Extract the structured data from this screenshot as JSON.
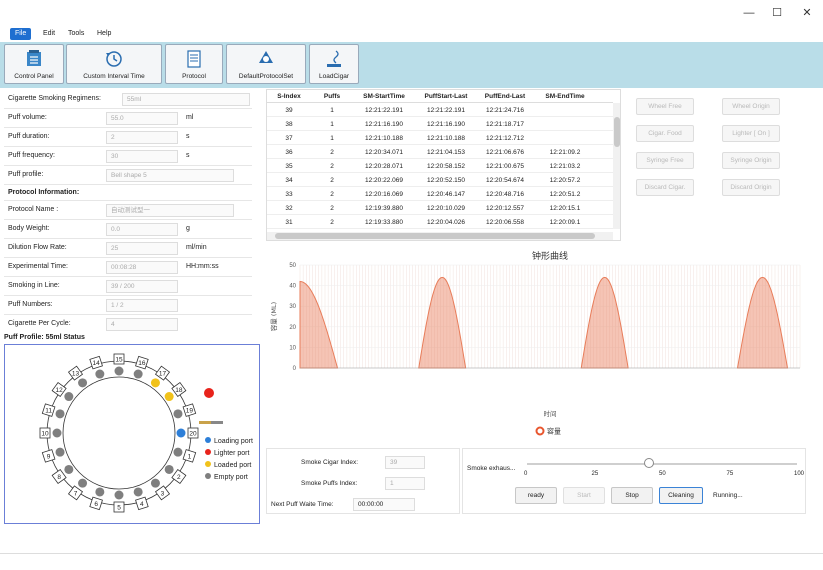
{
  "window": {
    "minimize": "—",
    "maximize": "☐",
    "close": "✕"
  },
  "menu": [
    "File",
    "Edit",
    "Tools",
    "Help"
  ],
  "toolbar": [
    {
      "label": "Control Panel",
      "icon": "control-panel-icon"
    },
    {
      "label": "Custom Interval Time",
      "icon": "clock-refresh-icon"
    },
    {
      "label": "Protocol",
      "icon": "document-icon"
    },
    {
      "label": "DefaultProtocolSet",
      "icon": "gears-icon"
    },
    {
      "label": "LoadCigar",
      "icon": "load-cigar-icon"
    }
  ],
  "form": {
    "regimen_label": "Cigarette Smoking Regimens:",
    "regimen_value": "55ml",
    "puff_volume_label": "Puff volume:",
    "puff_volume_value": "55.0",
    "puff_volume_unit": "ml",
    "puff_duration_label": "Puff duration:",
    "puff_duration_value": "2",
    "puff_duration_unit": "s",
    "puff_frequency_label": "Puff frequency:",
    "puff_frequency_value": "30",
    "puff_frequency_unit": "s",
    "puff_profile_label": "Puff profile:",
    "puff_profile_value": "Bell shape 5",
    "protocol_info_heading": "Protocol Information:",
    "protocol_name_label": "Protocol Name :",
    "protocol_name_value": "自动测试型一",
    "body_weight_label": "Body  Weight:",
    "body_weight_value": "0.0",
    "body_weight_unit": "g",
    "dilution_label": "Dilution Flow Rate:",
    "dilution_value": "25",
    "dilution_unit": "ml/min",
    "exp_time_label": "Experimental Time:",
    "exp_time_value": "00:08:28",
    "exp_time_unit": "HH:mm:ss",
    "smoking_line_label": "Smoking in Line:",
    "smoking_line_value": "39 / 200",
    "puff_numbers_label": "Puff Numbers:",
    "puff_numbers_value": "1 / 2",
    "cig_per_cycle_label": "Cigarette Per Cycle:",
    "cig_per_cycle_value": "4"
  },
  "status_title": "Puff Profile: 55ml Status",
  "wheel": {
    "numbers": [
      "13",
      "14",
      "15",
      "16",
      "17",
      "18",
      "19",
      "20",
      "1",
      "2",
      "3",
      "4",
      "5",
      "6",
      "7",
      "8",
      "9",
      "10",
      "11",
      "12"
    ],
    "legend": [
      {
        "label": "Loading port",
        "color": "#2d7fd8"
      },
      {
        "label": "Lighter port",
        "color": "#e8231b"
      },
      {
        "label": "Loaded port",
        "color": "#f1c21b"
      },
      {
        "label": "Empty port",
        "color": "#7f7f7f"
      }
    ]
  },
  "table": {
    "headers": [
      "S-Index",
      "Puffs",
      "SM-StartTime",
      "PuffStart-Last",
      "PuffEnd-Last",
      "SM-EndTime"
    ],
    "rows": [
      [
        "39",
        "1",
        "12:21:22.191",
        "12:21:22.191",
        "12:21:24.716",
        ""
      ],
      [
        "38",
        "1",
        "12:21:16.190",
        "12:21:16.190",
        "12:21:18.717",
        ""
      ],
      [
        "37",
        "1",
        "12:21:10.188",
        "12:21:10.188",
        "12:21:12.712",
        ""
      ],
      [
        "36",
        "2",
        "12:20:34.071",
        "12:21:04.153",
        "12:21:06.676",
        "12:21:09.2"
      ],
      [
        "35",
        "2",
        "12:20:28.071",
        "12:20:58.152",
        "12:21:00.675",
        "12:21:03.2"
      ],
      [
        "34",
        "2",
        "12:20:22.069",
        "12:20:52.150",
        "12:20:54.674",
        "12:20:57.2"
      ],
      [
        "33",
        "2",
        "12:20:16.069",
        "12:20:46.147",
        "12:20:48.716",
        "12:20:51.2"
      ],
      [
        "32",
        "2",
        "12:19:39.880",
        "12:20:10.029",
        "12:20:12.557",
        "12:20:15.1"
      ],
      [
        "31",
        "2",
        "12:19:33.880",
        "12:20:04.026",
        "12:20:06.558",
        "12:20:09.1"
      ]
    ]
  },
  "side_buttons": [
    "Wheel Free",
    "Wheel Origin",
    "Cigar. Food",
    "Lighter [ On ]",
    "Syringe Free",
    "Syringe Origin",
    "Discard Cigar.",
    "Discard Origin"
  ],
  "chart_data": {
    "type": "area",
    "title": "钟形曲线",
    "ylabel": "容量 (ML)",
    "xlabel": "时间",
    "legend": [
      "容量"
    ],
    "ylim": [
      0,
      50
    ],
    "yticks": [
      0,
      10,
      20,
      30,
      40,
      50
    ],
    "peaks": [
      {
        "start": 0,
        "end": 12,
        "peak": 42
      },
      {
        "start": 38,
        "end": 53,
        "peak": 44
      },
      {
        "start": 90,
        "end": 105,
        "peak": 44
      },
      {
        "start": 140,
        "end": 156,
        "peak": 44
      }
    ],
    "x_range": [
      0,
      160
    ],
    "color": "#e87d5a"
  },
  "bottom": {
    "smoke_cigar_index_label": "Smoke Cigar Index:",
    "smoke_cigar_index_value": "39",
    "smoke_puffs_index_label": "Smoke Puffs Index:",
    "smoke_puffs_index_value": "1",
    "next_puff_label": "Next Puff Waite Time:",
    "next_puff_value": "00:00:00",
    "exhaust_label": "Smoke exhaus...",
    "slider_ticks": [
      "0",
      "25",
      "50",
      "75",
      "100"
    ],
    "slider_value": 45,
    "btn_ready": "ready",
    "btn_start": "Start",
    "btn_stop": "Stop",
    "btn_cleaning": "Cleaning",
    "status": "Running..."
  }
}
